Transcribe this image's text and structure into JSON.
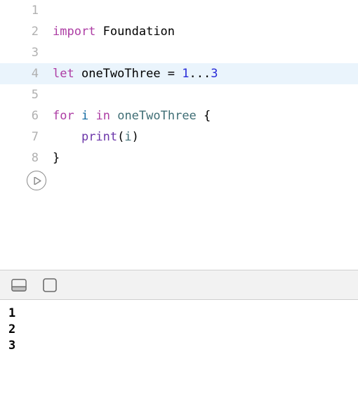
{
  "editor": {
    "highlightedLine": 4,
    "lines": [
      {
        "num": "1",
        "tokens": []
      },
      {
        "num": "2",
        "tokens": [
          {
            "cls": "kw",
            "text": "import"
          },
          {
            "cls": "plain",
            "text": " "
          },
          {
            "cls": "plain",
            "text": "Foundation"
          }
        ]
      },
      {
        "num": "3",
        "tokens": []
      },
      {
        "num": "4",
        "tokens": [
          {
            "cls": "kw",
            "text": "let"
          },
          {
            "cls": "plain",
            "text": " "
          },
          {
            "cls": "plain",
            "text": "oneTwoThree"
          },
          {
            "cls": "plain",
            "text": " = "
          },
          {
            "cls": "num",
            "text": "1"
          },
          {
            "cls": "plain",
            "text": "..."
          },
          {
            "cls": "num",
            "text": "3"
          }
        ]
      },
      {
        "num": "5",
        "tokens": []
      },
      {
        "num": "6",
        "tokens": [
          {
            "cls": "kw",
            "text": "for"
          },
          {
            "cls": "plain",
            "text": " "
          },
          {
            "cls": "ident",
            "text": "i"
          },
          {
            "cls": "plain",
            "text": " "
          },
          {
            "cls": "kw",
            "text": "in"
          },
          {
            "cls": "plain",
            "text": " "
          },
          {
            "cls": "type",
            "text": "oneTwoThree"
          },
          {
            "cls": "plain",
            "text": " {"
          }
        ]
      },
      {
        "num": "7",
        "tokens": [
          {
            "cls": "plain",
            "text": "    "
          },
          {
            "cls": "call",
            "text": "print"
          },
          {
            "cls": "plain",
            "text": "("
          },
          {
            "cls": "type",
            "text": "i"
          },
          {
            "cls": "plain",
            "text": ")"
          }
        ]
      },
      {
        "num": "8",
        "tokens": [
          {
            "cls": "plain",
            "text": "}"
          }
        ]
      }
    ]
  },
  "console": {
    "output": [
      "1",
      "2",
      "3"
    ]
  }
}
